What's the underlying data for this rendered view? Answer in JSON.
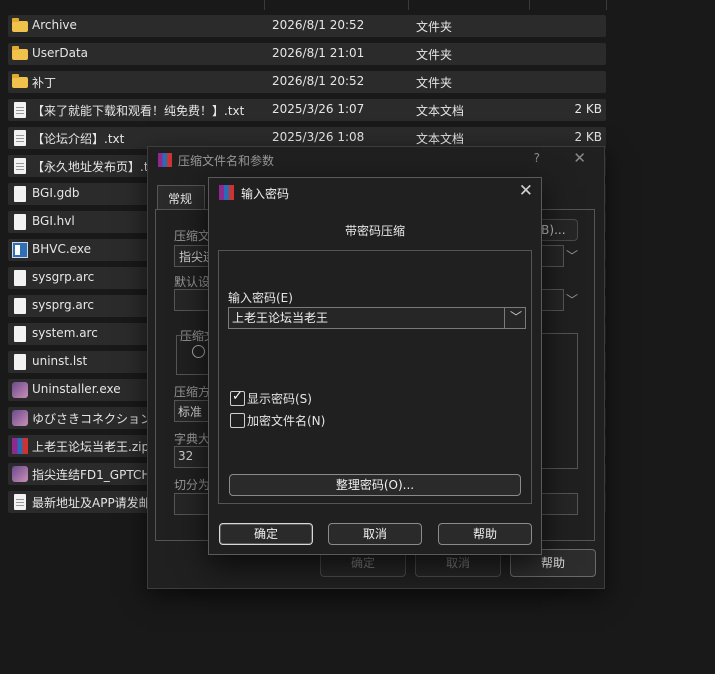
{
  "files": [
    {
      "name": "Archive",
      "date": "2026/8/1 20:52",
      "type": "文件夹",
      "size": "",
      "icon": "folder-icon"
    },
    {
      "name": "UserData",
      "date": "2026/8/1 21:01",
      "type": "文件夹",
      "size": "",
      "icon": "folder-icon"
    },
    {
      "name": "补丁",
      "date": "2026/8/1 20:52",
      "type": "文件夹",
      "size": "",
      "icon": "folder-icon"
    },
    {
      "name": "【来了就能下载和观看！纯免费！】.txt",
      "date": "2025/3/26 1:07",
      "type": "文本文档",
      "size": "2 KB",
      "icon": "text-document-icon"
    },
    {
      "name": "【论坛介绍】.txt",
      "date": "2025/3/26 1:08",
      "type": "文本文档",
      "size": "2 KB",
      "icon": "text-document-icon"
    },
    {
      "name": "【永久地址发布页】.t",
      "date": "",
      "type": "",
      "size": "",
      "icon": "text-document-icon"
    },
    {
      "name": "BGI.gdb",
      "date": "",
      "type": "",
      "size": "",
      "icon": "file-icon"
    },
    {
      "name": "BGI.hvl",
      "date": "",
      "type": "",
      "size": "",
      "icon": "file-icon"
    },
    {
      "name": "BHVC.exe",
      "date": "",
      "type": "",
      "size": "",
      "icon": "exe-icon"
    },
    {
      "name": "sysgrp.arc",
      "date": "",
      "type": "",
      "size": "",
      "icon": "file-icon"
    },
    {
      "name": "sysprg.arc",
      "date": "",
      "type": "",
      "size": "",
      "icon": "file-icon"
    },
    {
      "name": "system.arc",
      "date": "",
      "type": "",
      "size": "",
      "icon": "file-icon"
    },
    {
      "name": "uninst.lst",
      "date": "",
      "type": "",
      "size": "",
      "icon": "file-icon"
    },
    {
      "name": "Uninstaller.exe",
      "date": "",
      "type": "",
      "size": "",
      "icon": "anime-app-icon"
    },
    {
      "name": "ゆびさきコネクション",
      "date": "",
      "type": "",
      "size": "",
      "icon": "anime-app-icon"
    },
    {
      "name": "上老王论坛当老王.zip",
      "date": "",
      "type": "",
      "size": "",
      "icon": "winrar-archive-icon"
    },
    {
      "name": "指尖连结FD1_GPTCH",
      "date": "",
      "type": "",
      "size": "",
      "icon": "anime-app-icon"
    },
    {
      "name": "最新地址及APP请发邮",
      "date": "",
      "type": "",
      "size": "",
      "icon": "text-document-icon"
    }
  ],
  "archive_dialog": {
    "title": "压缩文件名和参数",
    "help_glyph": "?",
    "close_glyph": "✕",
    "tab_general": "常规",
    "label_archive_name": "压缩文",
    "archive_name_value": "指尖连",
    "browse_label": "(B)...",
    "label_default_settings": "默认设",
    "label_format": "压缩文",
    "label_method": "压缩方",
    "method_value": "标准",
    "label_dictionary": "字典大",
    "dictionary_value": "32",
    "label_split": "切分为",
    "ok_label": "确定",
    "cancel_label": "取消",
    "help_label": "帮助"
  },
  "password_dialog": {
    "title": "输入密码",
    "close_glyph": "✕",
    "subtitle": "带密码压缩",
    "password_label": "输入密码(E)",
    "password_value": "上老王论坛当老王",
    "dropdown_glyph": "﹀",
    "show_password_label": "显示密码(S)",
    "show_password_checked": true,
    "encrypt_names_label": "加密文件名(N)",
    "encrypt_names_checked": false,
    "organize_label": "整理密码(O)...",
    "ok_label": "确定",
    "cancel_label": "取消",
    "help_label": "帮助"
  }
}
